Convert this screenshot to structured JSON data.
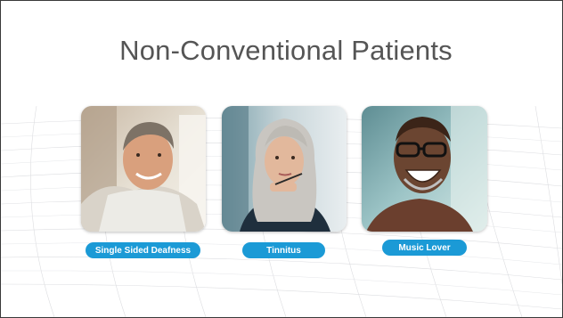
{
  "slide": {
    "title": "Non-Conventional Patients",
    "cards": [
      {
        "label": "Single Sided Deafness"
      },
      {
        "label": "Tinnitus"
      },
      {
        "label": "Music Lover"
      }
    ]
  },
  "colors": {
    "accent": "#1b9ad6",
    "title_text": "#555555",
    "border": "#3a3a3a"
  }
}
